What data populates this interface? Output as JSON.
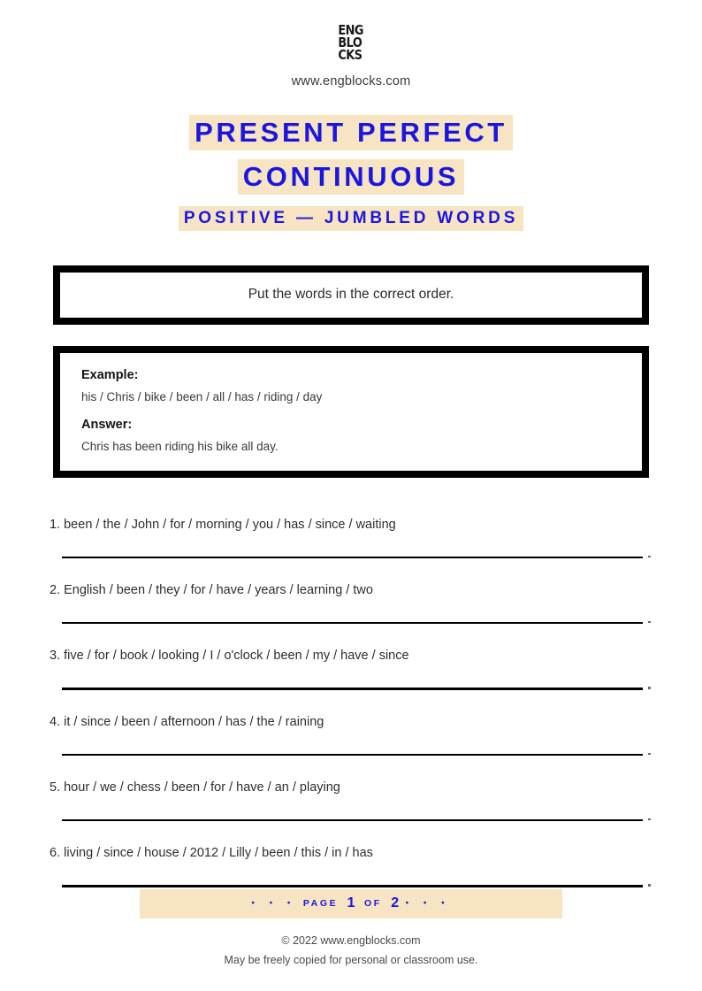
{
  "header": {
    "logo_lines": [
      "ENG",
      "BLO",
      "CKS"
    ],
    "logo_alt": "engblocks-logo",
    "site_url": "www.engblocks.com"
  },
  "title": {
    "line1": "PRESENT PERFECT",
    "line2": "CONTINUOUS",
    "subtitle": "POSITIVE — JUMBLED WORDS",
    "highlight_color": "#f6e4c2",
    "text_color": "#1a16e0"
  },
  "instruction": {
    "text": "Put the words in the correct order."
  },
  "example": {
    "example_label": "Example:",
    "example_text": "his / Chris / bike / been / all / has / riding / day",
    "answer_label": "Answer:",
    "answer_text": "Chris has been riding his bike all day."
  },
  "questions": [
    {
      "number": "1.",
      "text": "1. been / the / John / for / morning / you / has / since / waiting"
    },
    {
      "number": "2.",
      "text": "2. English / been / they / for / have / years / learning / two"
    },
    {
      "number": "3.",
      "text": "3. five / for / book / looking / I / o'clock / been / my / have / since"
    },
    {
      "number": "4.",
      "text": "4. it / since / been / afternoon / has / the / raining"
    },
    {
      "number": "5.",
      "text": "5. hour / we / chess / been / for / have / an / playing"
    },
    {
      "number": "6.",
      "text": "6. living / since / house / 2012 / Lilly / been / this / in / has"
    }
  ],
  "footer": {
    "dots_left": "• • •",
    "page_word": "PAGE",
    "page_number": "1",
    "of_word": "OF",
    "total_pages": "2",
    "dots_right": "• • •",
    "copyright": "© 2022 www.engblocks.com",
    "license": "May be freely copied for personal or classroom use."
  }
}
